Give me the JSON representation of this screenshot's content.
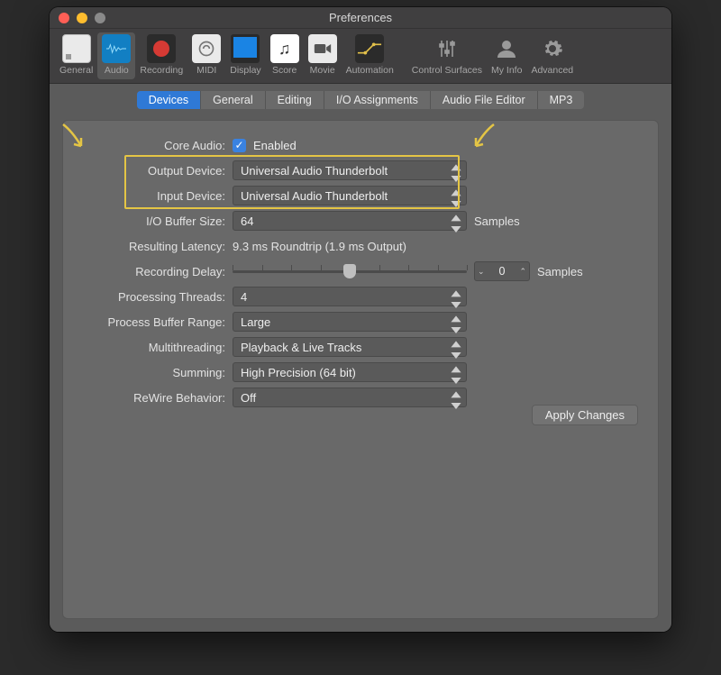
{
  "window": {
    "title": "Preferences"
  },
  "toolbar": {
    "general": "General",
    "audio": "Audio",
    "recording": "Recording",
    "midi": "MIDI",
    "display": "Display",
    "score": "Score",
    "movie": "Movie",
    "automation": "Automation",
    "control_surfaces": "Control Surfaces",
    "my_info": "My Info",
    "advanced": "Advanced"
  },
  "subtabs": {
    "devices": "Devices",
    "general": "General",
    "editing": "Editing",
    "io": "I/O Assignments",
    "afe": "Audio File Editor",
    "mp3": "MP3"
  },
  "labels": {
    "core_audio": "Core Audio:",
    "enabled": "Enabled",
    "output_device": "Output Device:",
    "input_device": "Input Device:",
    "io_buffer": "I/O Buffer Size:",
    "resulting_latency": "Resulting Latency:",
    "recording_delay": "Recording Delay:",
    "processing_threads": "Processing Threads:",
    "process_buffer_range": "Process Buffer Range:",
    "multithreading": "Multithreading:",
    "summing": "Summing:",
    "rewire": "ReWire Behavior:",
    "samples": "Samples",
    "apply": "Apply Changes"
  },
  "values": {
    "output_device": "Universal Audio Thunderbolt",
    "input_device": "Universal Audio Thunderbolt",
    "io_buffer": "64",
    "resulting_latency": "9.3 ms Roundtrip (1.9 ms Output)",
    "recording_delay": "0",
    "processing_threads": "4",
    "process_buffer_range": "Large",
    "multithreading": "Playback & Live Tracks",
    "summing": "High Precision (64 bit)",
    "rewire": "Off"
  }
}
